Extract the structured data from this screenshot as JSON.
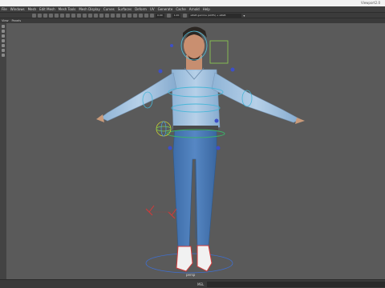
{
  "window": {
    "right_text": "Viewport2.0"
  },
  "menus": [
    "File",
    "Windows",
    "Mesh",
    "Edit Mesh",
    "Mesh Tools",
    "Mesh Display",
    "Curves",
    "Surfaces",
    "Deform",
    "UV",
    "Generate",
    "Cache",
    "Arnold",
    "Help"
  ],
  "status_line": {
    "field1": "0.00",
    "field2": "1.00",
    "camera_select": "sRGB gamma (ACES) + sRGB"
  },
  "panel_menus": [
    "View",
    "Panels"
  ],
  "viewport": {
    "ground_label": "persp"
  },
  "help_line": {
    "label": "MEL"
  }
}
